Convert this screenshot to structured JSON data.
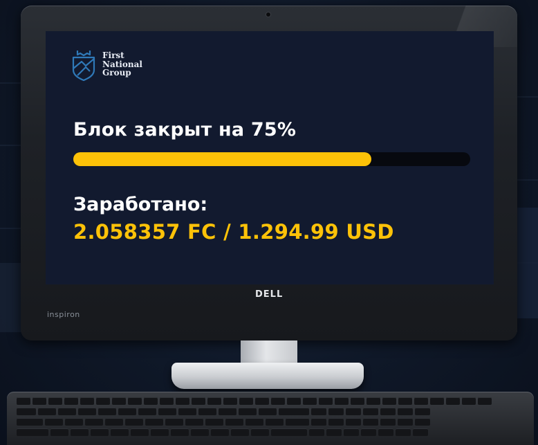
{
  "screen": {
    "logo": {
      "text": "First\nNational\nGroup",
      "icon": "crown-shield-icon"
    },
    "status_text": "Блок закрыт на 75%",
    "progress": {
      "percent": 75
    },
    "earned_label": "Заработано:",
    "earned_value": "2.058357 FC / 1.294.99 USD"
  },
  "device": {
    "brand": "DELL",
    "model": "inspiron"
  },
  "colors": {
    "accent": "#fdc208",
    "screen_background": "#121a2f",
    "text_primary": "#ffffff"
  }
}
